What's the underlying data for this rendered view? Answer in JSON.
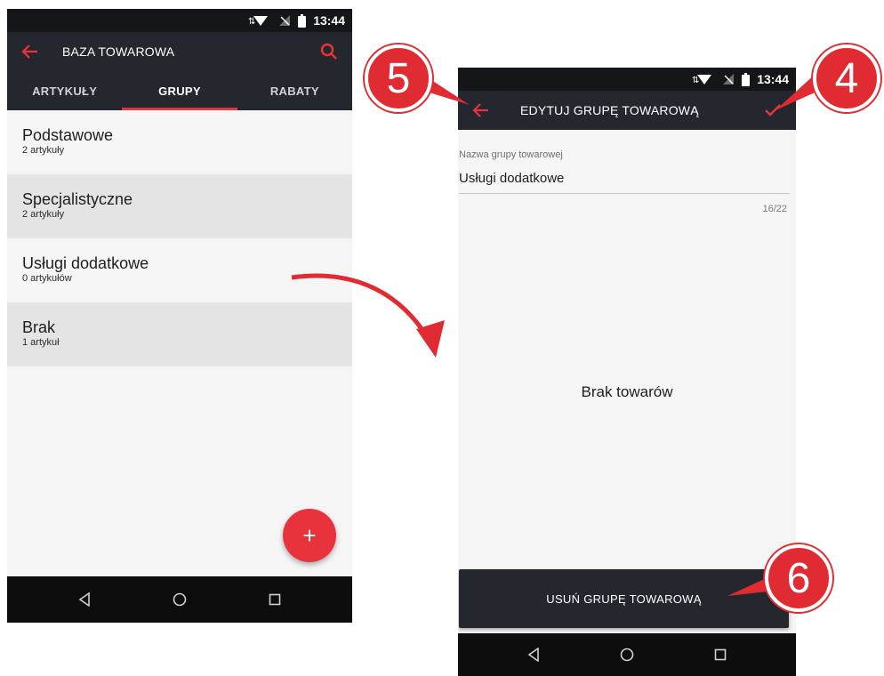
{
  "statusbar": {
    "time": "13:44"
  },
  "left": {
    "title": "BAZA TOWAROWA",
    "tabs": [
      {
        "label": "ARTYKUŁY",
        "active": false
      },
      {
        "label": "GRUPY",
        "active": true
      },
      {
        "label": "RABATY",
        "active": false
      }
    ],
    "groups": [
      {
        "name": "Podstawowe",
        "count": "2 artykuły"
      },
      {
        "name": "Specjalistyczne",
        "count": "2 artykuły"
      },
      {
        "name": "Usługi dodatkowe",
        "count": "0 artykułów"
      },
      {
        "name": "Brak",
        "count": "1 artykuł"
      }
    ],
    "fab_label": "+"
  },
  "right": {
    "title": "EDYTUJ GRUPĘ TOWAROWĄ",
    "field_label": "Nazwa grupy towarowej",
    "field_value": "Usługi dodatkowe",
    "counter": "16/22",
    "empty_message": "Brak towarów",
    "delete_label": "USUŃ GRUPĘ TOWAROWĄ"
  },
  "callouts": {
    "back": "5",
    "confirm": "4",
    "delete": "6"
  },
  "colors": {
    "accent": "#e8333c",
    "appbar": "#24282e",
    "statusbar": "#141619",
    "navbar": "#0d0d0d"
  },
  "icons": [
    "back-arrow-icon",
    "search-icon",
    "check-icon",
    "nav-back-icon",
    "nav-home-icon",
    "nav-recents-icon",
    "wifi-icon",
    "signal-icon",
    "battery-icon"
  ]
}
